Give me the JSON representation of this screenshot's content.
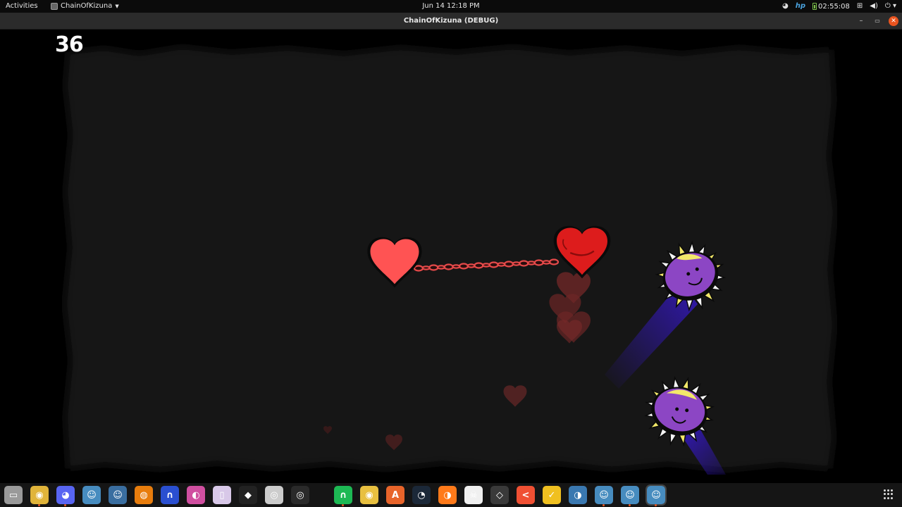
{
  "topbar": {
    "activities": "Activities",
    "app_name": "ChainOfKizuna",
    "clock": "Jun 14  12:18 PM",
    "timer": "02:55:08"
  },
  "window": {
    "title": "ChainOfKizuna (DEBUG)",
    "minimize_glyph": "–",
    "maximize_glyph": "▭",
    "close_glyph": "✕"
  },
  "game": {
    "score": "36",
    "colors": {
      "arena_bg": "#141414",
      "heart_light": "#ff5353",
      "heart_dark": "#dd1c1c",
      "chain": "#e64a4a",
      "enemy_body": "#8c46c4",
      "enemy_spikes": "#f2e86a",
      "trail": "#3318b8"
    }
  },
  "dock": {
    "apps": [
      {
        "icon": "files-icon",
        "color": "#9a9a9a",
        "glyph": "▭",
        "running": false
      },
      {
        "icon": "chrome-icon",
        "color": "#e0b43a",
        "glyph": "◉",
        "running": true
      },
      {
        "icon": "discord-icon",
        "color": "#5865f2",
        "glyph": "◕",
        "running": true
      },
      {
        "icon": "godot-icon",
        "color": "#478cbf",
        "glyph": "☺",
        "running": false
      },
      {
        "icon": "godot-icon",
        "color": "#3a6ea0",
        "glyph": "☺",
        "running": false
      },
      {
        "icon": "blender-icon",
        "color": "#e87d0d",
        "glyph": "◍",
        "running": false
      },
      {
        "icon": "headphones-icon",
        "color": "#2a4fd0",
        "glyph": "∩",
        "running": false
      },
      {
        "icon": "krita-icon",
        "color": "#d04fa0",
        "glyph": "◐",
        "running": false
      },
      {
        "icon": "notes-icon",
        "color": "#d8c8e8",
        "glyph": "▯",
        "running": false
      },
      {
        "icon": "inkscape-icon",
        "color": "#222222",
        "glyph": "◆",
        "running": false
      },
      {
        "icon": "obs-icon",
        "color": "#cccccc",
        "glyph": "◎",
        "running": false
      },
      {
        "icon": "obs-studio-icon",
        "color": "#2a2a2a",
        "glyph": "◎",
        "running": false
      },
      {
        "icon": "spotify-icon",
        "color": "#1db954",
        "glyph": "∩",
        "running": true
      },
      {
        "icon": "rhythmbox-icon",
        "color": "#e8c040",
        "glyph": "◉",
        "running": false
      },
      {
        "icon": "software-icon",
        "color": "#e8642a",
        "glyph": "A",
        "running": false
      },
      {
        "icon": "steam-icon",
        "color": "#1b2838",
        "glyph": "◔",
        "running": false
      },
      {
        "icon": "firefox-icon",
        "color": "#ff7a1a",
        "glyph": "◑",
        "running": false
      },
      {
        "icon": "pirate-icon",
        "color": "#f0f0f0",
        "glyph": "☠",
        "running": false
      },
      {
        "icon": "unity-icon",
        "color": "#3a3a3a",
        "glyph": "◇",
        "running": false
      },
      {
        "icon": "git-icon",
        "color": "#f05033",
        "glyph": "<",
        "running": false
      },
      {
        "icon": "vscode-icon",
        "color": "#f0c020",
        "glyph": "✓",
        "running": false
      },
      {
        "icon": "python-icon",
        "color": "#3a78b0",
        "glyph": "◑",
        "running": false
      },
      {
        "icon": "godot-icon",
        "color": "#478cbf",
        "glyph": "☺",
        "running": true
      },
      {
        "icon": "godot-icon",
        "color": "#478cbf",
        "glyph": "☺",
        "running": true
      },
      {
        "icon": "godot-icon",
        "color": "#478cbf",
        "glyph": "☺",
        "running": true
      }
    ]
  }
}
